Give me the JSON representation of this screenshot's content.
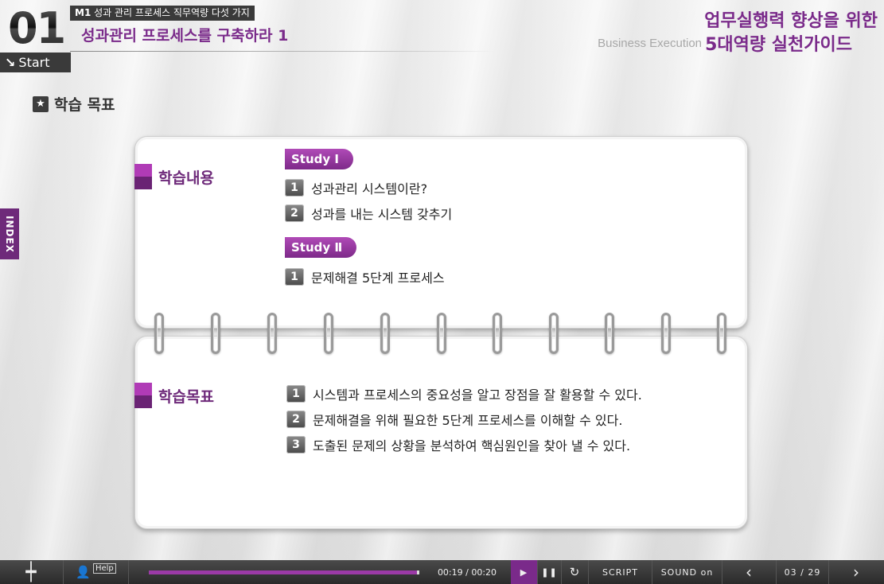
{
  "header": {
    "chapter_number": "01",
    "module_tag_bold": "M1",
    "module_tag": "성과 관리 프로세스 직무역량 다섯 가지",
    "page_title": "성과관리 프로세스를 구축하라 1",
    "start_label": "Start",
    "course_title_line1": "업무실행력 향상을 위한",
    "course_title_en": "Business Execution",
    "course_title_line2": "5대역량 실천가이드"
  },
  "section_heading": "학습 목표",
  "index_label": "INDEX",
  "learning_content": {
    "label": "학습내용",
    "studies": [
      {
        "badge": "Study Ⅰ",
        "items": [
          {
            "num": "1",
            "text": "성과관리 시스템이란?"
          },
          {
            "num": "2",
            "text": "성과를 내는 시스템 갖추기"
          }
        ]
      },
      {
        "badge": "Study Ⅱ",
        "items": [
          {
            "num": "1",
            "text": "문제해결 5단계 프로세스"
          }
        ]
      }
    ]
  },
  "learning_goals": {
    "label": "학습목표",
    "items": [
      {
        "num": "1",
        "text": "시스템과 프로세스의 중요성을 알고 장점을 잘 활용할 수 있다."
      },
      {
        "num": "2",
        "text": "문제해결을 위해 필요한 5단계 프로세스를 이해할 수 있다."
      },
      {
        "num": "3",
        "text": "도출된 문제의 상황을 분석하여 핵심원인을 찾아 낼 수 있다."
      }
    ]
  },
  "toolbar": {
    "help_label": "Help",
    "progress": 0.99,
    "time_display": "00:19 / 00:20",
    "script_label": "SCRIPT",
    "sound_label": "SOUND on",
    "page_display": "03 / 29"
  },
  "colors": {
    "accent_purple": "#7a2a8a",
    "toolbar_dark": "#2a2a2a"
  }
}
